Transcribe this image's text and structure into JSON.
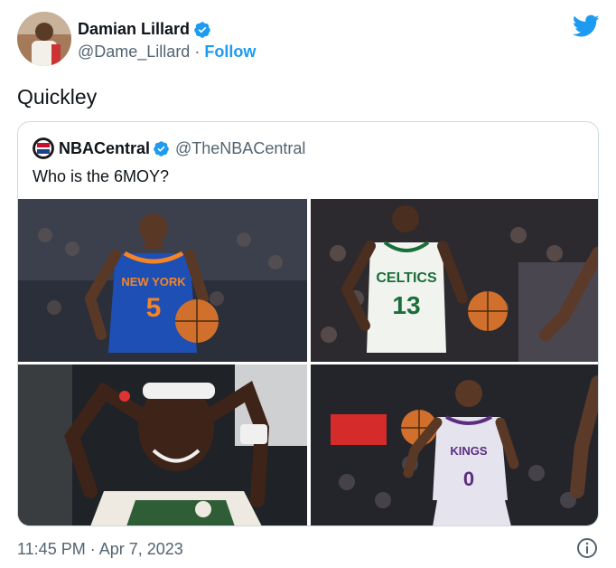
{
  "author": {
    "name": "Damian Lillard",
    "handle": "@Dame_Lillard",
    "separator": "·",
    "follow_label": "Follow"
  },
  "tweet": {
    "text": "Quickley"
  },
  "quoted": {
    "name": "NBACentral",
    "handle": "@TheNBACentral",
    "text": "Who is the 6MOY?",
    "images": [
      {
        "jersey_team": "NEW YORK",
        "jersey_number": "5",
        "jersey_color": "#1d4fb5"
      },
      {
        "jersey_team": "CELTICS",
        "jersey_number": "13",
        "jersey_color": "#f1f3ef"
      },
      {
        "jersey_team": "",
        "jersey_number": "",
        "jersey_color": "#2f5d35"
      },
      {
        "jersey_team": "KINGS",
        "jersey_number": "0",
        "jersey_color": "#e5e3ee"
      }
    ]
  },
  "footer": {
    "timestamp": "11:45 PM · Apr 7, 2023"
  },
  "colors": {
    "accent": "#1d9bf0",
    "text": "#0f1419",
    "muted": "#536471",
    "border": "#cfd9de"
  },
  "icons": [
    "verified-badge-icon",
    "twitter-bird-icon",
    "info-icon"
  ]
}
